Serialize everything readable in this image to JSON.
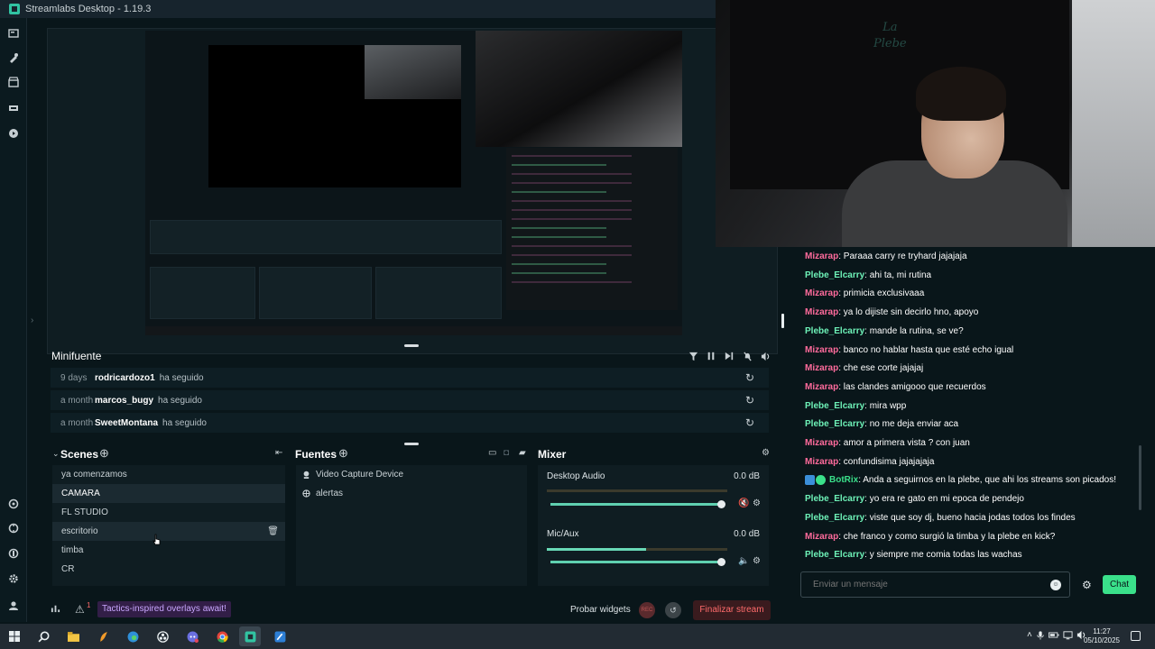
{
  "window": {
    "title": "Streamlabs Desktop - 1.19.3"
  },
  "minifeed": {
    "title": "Minifuente",
    "rows": [
      {
        "time": "9 days",
        "user": "rodricardozo1",
        "action": "ha seguido"
      },
      {
        "time": "a month",
        "user": "marcos_bugy",
        "action": "ha seguido"
      },
      {
        "time": "a month",
        "user": "SweetMontana",
        "action": "ha seguido"
      }
    ]
  },
  "scenes": {
    "title": "Scenes",
    "items": [
      "ya comenzamos",
      "CAMARA",
      "FL STUDIO",
      "escritorio",
      "timba",
      "CR"
    ]
  },
  "sources": {
    "title": "Fuentes",
    "items": [
      {
        "label": "Video Capture Device",
        "icon": "camera-icon"
      },
      {
        "label": "alertas",
        "icon": "globe-icon"
      }
    ]
  },
  "mixer": {
    "title": "Mixer",
    "channels": [
      {
        "name": "Desktop Audio",
        "db": "0.0 dB",
        "level": 0.0
      },
      {
        "name": "Mic/Aux",
        "db": "0.0 dB",
        "level": 0.55
      }
    ]
  },
  "footer": {
    "notifications_count": "1",
    "promo": "Tactics-inspired overlays await!",
    "test_widgets": "Probar widgets",
    "rec": "REC",
    "go_live": "Finalizar stream"
  },
  "webcam": {
    "neon_sign_line1": "La",
    "neon_sign_line2": "Plebe"
  },
  "chat": {
    "messages": [
      {
        "user": "Mizarap",
        "color": "#ff6b9c",
        "text": ": Paraaa carry re tryhard jajajaja"
      },
      {
        "user": "Plebe_Elcarry",
        "color": "#6ef2b8",
        "text": ": ahi ta, mi rutina"
      },
      {
        "user": "Mizarap",
        "color": "#ff6b9c",
        "text": ": primicia exclusivaaa"
      },
      {
        "user": "Mizarap",
        "color": "#ff6b9c",
        "text": ": ya lo dijiste sin decirlo hno, apoyo"
      },
      {
        "user": "Plebe_Elcarry",
        "color": "#6ef2b8",
        "text": ": mande la rutina, se ve?"
      },
      {
        "user": "Mizarap",
        "color": "#ff6b9c",
        "text": ": banco no hablar hasta que esté echo igual"
      },
      {
        "user": "Mizarap",
        "color": "#ff6b9c",
        "text": ": che ese corte jajajaj"
      },
      {
        "user": "Mizarap",
        "color": "#ff6b9c",
        "text": ": las clandes amigooo que recuerdos"
      },
      {
        "user": "Plebe_Elcarry",
        "color": "#6ef2b8",
        "text": ": mira wpp"
      },
      {
        "user": "Plebe_Elcarry",
        "color": "#6ef2b8",
        "text": ": no me deja enviar aca"
      },
      {
        "user": "Mizarap",
        "color": "#ff6b9c",
        "text": ": amor a primera vista ? con juan"
      },
      {
        "user": "Mizarap",
        "color": "#ff6b9c",
        "text": ": confundisima jajajajaja"
      },
      {
        "user": "BotRix",
        "color": "#3ae08a",
        "text": ": Anda a seguirnos en la plebe, que ahi los streams son picados!",
        "bot": true
      },
      {
        "user": "Plebe_Elcarry",
        "color": "#6ef2b8",
        "text": ": yo era re gato en mi epoca de pendejo"
      },
      {
        "user": "Plebe_Elcarry",
        "color": "#6ef2b8",
        "text": ": viste que soy dj, bueno hacia jodas todos los findes"
      },
      {
        "user": "Mizarap",
        "color": "#ff6b9c",
        "text": ": che franco y como surgió la timba y la plebe en kick?"
      },
      {
        "user": "Plebe_Elcarry",
        "color": "#6ef2b8",
        "text": ": y siempre me comia todas las wachas"
      }
    ],
    "input_placeholder": "Enviar un mensaje",
    "send_label": "Chat"
  },
  "taskbar": {
    "time": "11:27",
    "date": "05/10/2025"
  }
}
